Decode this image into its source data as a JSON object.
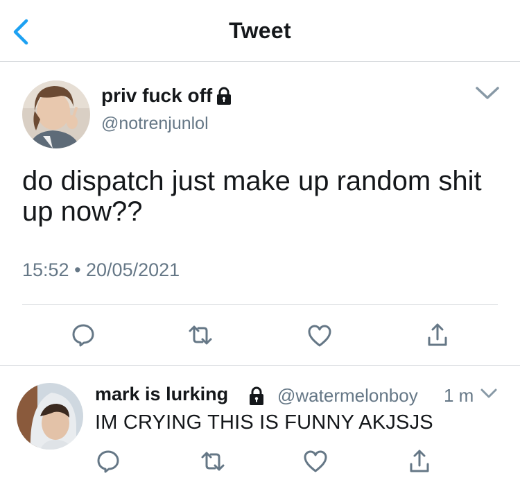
{
  "header": {
    "title": "Tweet",
    "back_icon": "chevron-left-icon"
  },
  "main_tweet": {
    "display_name": "priv fuck off",
    "handle": "@notrenjunlol",
    "text": "do dispatch just make up random shit up now??",
    "timestamp": "15:52 • 20/05/2021",
    "protected": true,
    "icons": [
      "reply-icon",
      "retweet-icon",
      "like-icon",
      "share-icon"
    ]
  },
  "reply_tweet": {
    "display_name": "mark is lurking",
    "handle": "@watermelonboy",
    "time_ago": "1 m",
    "text": "IM CRYING THIS IS FUNNY AKJSJS",
    "protected": true,
    "icons": [
      "reply-icon",
      "retweet-icon",
      "like-icon",
      "share-icon"
    ]
  },
  "colors": {
    "accent": "#1da1f2",
    "text_primary": "#14171a",
    "text_secondary": "#657786",
    "divider": "#d3d7db"
  }
}
